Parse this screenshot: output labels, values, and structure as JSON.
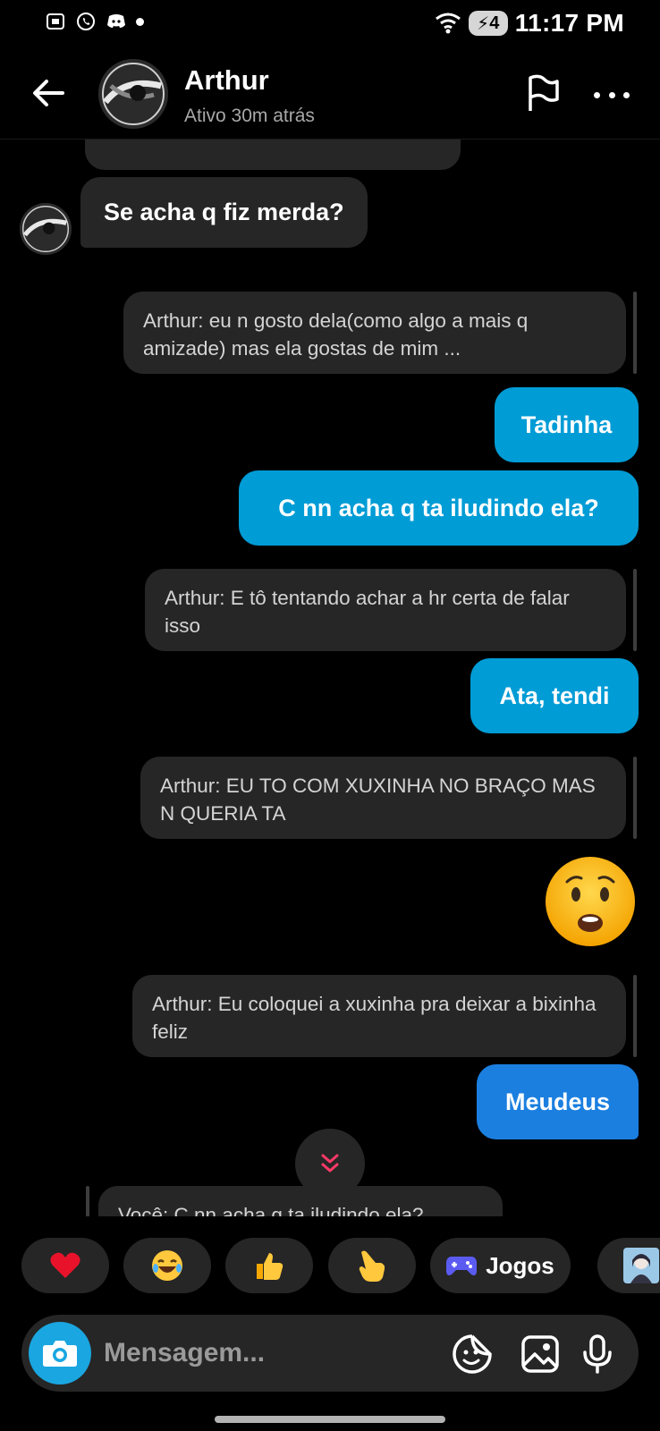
{
  "status_bar": {
    "time": "11:17 PM",
    "battery_label": "4",
    "icons": [
      "screenshot-icon",
      "whatsapp-icon",
      "discord-icon",
      "notification-dot",
      "wifi-icon"
    ]
  },
  "header": {
    "name": "Arthur",
    "status": "Ativo 30m atrás",
    "icons": [
      "back-arrow-icon",
      "avatar",
      "flag-icon",
      "more-icon"
    ]
  },
  "messages": [
    {
      "kind": "incoming",
      "text": "Se acha q fiz merda?"
    },
    {
      "kind": "reply",
      "text": "Arthur: eu n gosto dela(como algo a mais q amizade) mas ela gostas de mim ..."
    },
    {
      "kind": "outgoing",
      "text": "Tadinha"
    },
    {
      "kind": "outgoing",
      "text": "C nn acha q ta iludindo ela?"
    },
    {
      "kind": "reply",
      "text": "Arthur: E tô tentando achar a hr certa de falar isso"
    },
    {
      "kind": "outgoing",
      "text": "Ata, tendi"
    },
    {
      "kind": "reply",
      "text": "Arthur: EU TO COM XUXINHA NO BRAÇO MAS N QUERIA TA"
    },
    {
      "kind": "emoji",
      "icon": "astonished-face-emoji"
    },
    {
      "kind": "reply",
      "text": "Arthur: Eu coloquei a xuxinha pra deixar a bixinha feliz"
    },
    {
      "kind": "outgoing",
      "text": "Meudeus"
    },
    {
      "kind": "reply",
      "text": "Você: C nn acha q ta iludindo ela?"
    }
  ],
  "quick_reactions": {
    "items": [
      "heart-emoji",
      "laughing-emoji",
      "thumbs-up-emoji",
      "pointing-hand-emoji",
      "gamepad-icon",
      "sticker-thumbnail"
    ],
    "jogos_label": "Jogos"
  },
  "composer": {
    "placeholder": "Mensagem...",
    "icons": [
      "camera-icon",
      "sticker-icon",
      "gallery-icon",
      "microphone-icon"
    ]
  },
  "colors": {
    "background": "#000000",
    "incoming_bubble": "#262626",
    "outgoing_bubble": "#009cd6",
    "outgoing_bubble_last": "#1b7fe0",
    "camera_button": "#1aa6e0"
  }
}
